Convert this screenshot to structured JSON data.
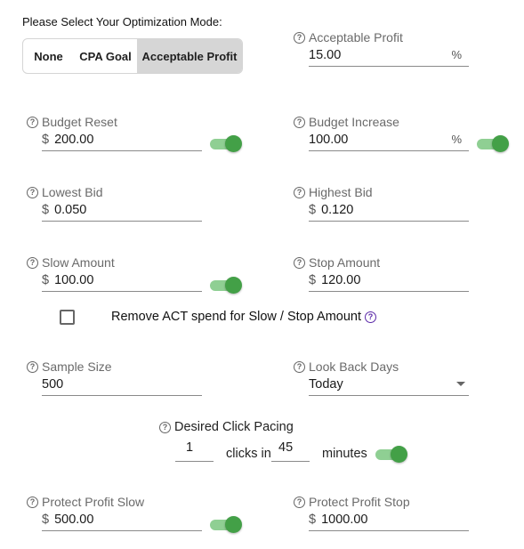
{
  "mode": {
    "title": "Please Select Your Optimization Mode:",
    "options": [
      "None",
      "CPA Goal",
      "Acceptable Profit"
    ],
    "selected": "Acceptable Profit"
  },
  "acceptable_profit": {
    "label": "Acceptable Profit",
    "value": "15.00",
    "suffix": "%"
  },
  "budget_reset": {
    "label": "Budget Reset",
    "prefix": "$",
    "value": "200.00",
    "toggle_on": true
  },
  "budget_increase": {
    "label": "Budget Increase",
    "value": "100.00",
    "suffix": "%",
    "toggle_on": true
  },
  "lowest_bid": {
    "label": "Lowest Bid",
    "prefix": "$",
    "value": "0.050"
  },
  "highest_bid": {
    "label": "Highest Bid",
    "prefix": "$",
    "value": "0.120"
  },
  "slow_amount": {
    "label": "Slow Amount",
    "prefix": "$",
    "value": "100.00",
    "toggle_on": true
  },
  "stop_amount": {
    "label": "Stop Amount",
    "prefix": "$",
    "value": "120.00"
  },
  "remove_act": {
    "label": "Remove ACT spend for Slow / Stop Amount",
    "checked": false
  },
  "sample_size": {
    "label": "Sample Size",
    "value": "500"
  },
  "look_back_days": {
    "label": "Look Back Days",
    "value": "Today"
  },
  "pacing": {
    "title": "Desired Click Pacing",
    "clicks": "1",
    "clicks_in_label": "clicks in",
    "minutes": "45",
    "minutes_label": "minutes",
    "toggle_on": true
  },
  "protect_profit_slow": {
    "label": "Protect Profit Slow",
    "prefix": "$",
    "value": "500.00",
    "toggle_on": true
  },
  "protect_profit_stop": {
    "label": "Protect Profit Stop",
    "prefix": "$",
    "value": "1000.00"
  },
  "help_glyph": "?",
  "colors": {
    "toggle_thumb": "#43a047",
    "toggle_track": "#8fcf93",
    "segment_active": "#d6d6d6"
  }
}
